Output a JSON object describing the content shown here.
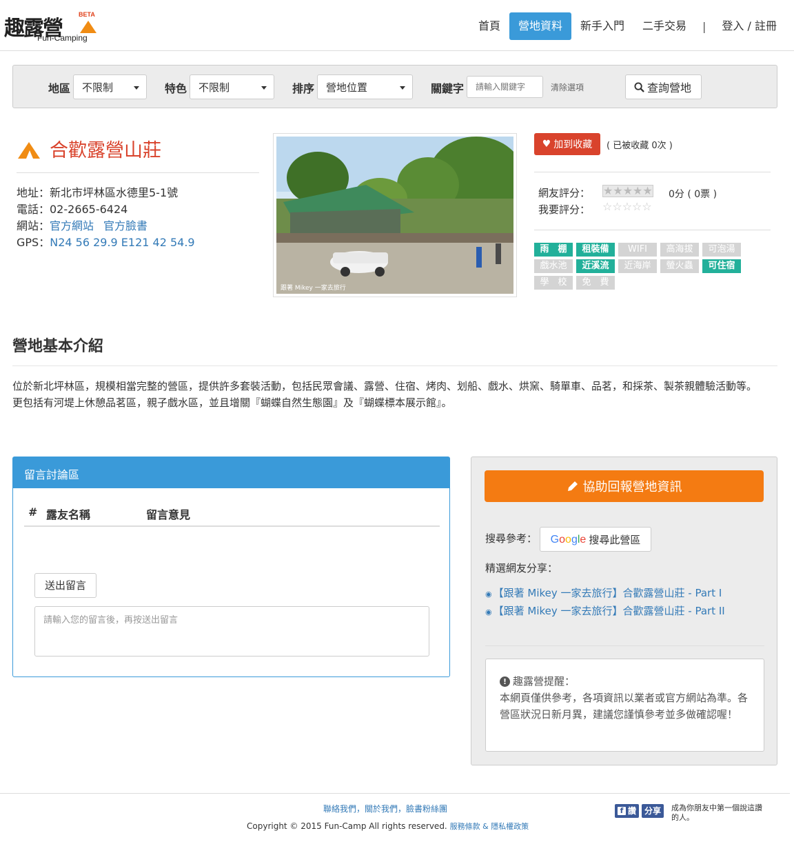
{
  "brand": {
    "name": "趣露營",
    "sub": "Fun-Camping",
    "beta": "BETA"
  },
  "nav": {
    "items": [
      {
        "label": "首頁",
        "active": false
      },
      {
        "label": "營地資料",
        "active": true
      },
      {
        "label": "新手入門",
        "active": false
      },
      {
        "label": "二手交易",
        "active": false
      }
    ],
    "separator": "|",
    "login": "登入 / 註冊"
  },
  "filter": {
    "region_label": "地區",
    "region_value": "不限制",
    "feature_label": "特色",
    "feature_value": "不限制",
    "sort_label": "排序",
    "sort_value": "營地位置",
    "keyword_label": "關鍵字",
    "keyword_placeholder": "請輸入關鍵字",
    "clear": "清除選項",
    "search_button": "查詢營地"
  },
  "camp": {
    "name": "合歡露營山莊",
    "address": "地址：新北市坪林區水德里5-1號",
    "phone": "電話：02-2665-6424",
    "website_label": "網站：",
    "website_links": [
      "官方網站",
      "官方臉書"
    ],
    "gps_label": "GPS：",
    "gps_value": "N24 56 29.9 E121 42 54.9",
    "photo_caption": "跟著 Mikey 一家去旅行"
  },
  "favorite": {
    "button": "加到收藏",
    "count_text": "( 已被收藏 0次 )"
  },
  "rating": {
    "user_label": "網友評分：",
    "my_label": "我要評分：",
    "stars": "★★★★★",
    "empty_stars": "☆☆☆☆☆",
    "value_text": "0分 ( 0票 )"
  },
  "tags": [
    {
      "label": "雨　棚",
      "on": true
    },
    {
      "label": "租裝備",
      "on": true
    },
    {
      "label": "WIFI",
      "on": false
    },
    {
      "label": "高海拔",
      "on": false
    },
    {
      "label": "可泡湯",
      "on": false
    },
    {
      "label": "戲水池",
      "on": false
    },
    {
      "label": "近溪流",
      "on": true
    },
    {
      "label": "近海岸",
      "on": false
    },
    {
      "label": "螢火蟲",
      "on": false
    },
    {
      "label": "可住宿",
      "on": true
    },
    {
      "label": "學　校",
      "on": false
    },
    {
      "label": "免　費",
      "on": false
    }
  ],
  "intro": {
    "title": "營地基本介紹",
    "line1": "位於新北坪林區，規模相當完整的營區，提供許多套裝活動，包括民眾會議、露營、住宿、烤肉、划船、戲水、烘窯、騎單車、品茗，和採茶、製茶親體驗活動等。",
    "line2": "更包括有河堤上休憩品茗區，親子戲水區，並且增關『蝴蝶自然生態園』及『蝴蝶標本展示館』。"
  },
  "comments": {
    "title": "留言討論區",
    "col_num": "#",
    "col_name": "露友名稱",
    "col_msg": "留言意見",
    "send": "送出留言",
    "placeholder": "請輸入您的留言後，再按送出留言"
  },
  "sidebar": {
    "report": "協助回報營地資訊",
    "search_label": "搜尋參考：",
    "google_button": "搜尋此營區",
    "share_label": "精選網友分享：",
    "links": [
      "【跟著 Mikey 一家去旅行】合歡露營山莊 - Part I",
      "【跟著 Mikey 一家去旅行】合歡露營山莊 - Part II"
    ],
    "note_title": "趣露營提醒：",
    "note_body": "本網頁僅供參考，各項資訊以業者或官方網站為準。各營區狀況日新月異，建議您謹慎參考並多做確認喔！"
  },
  "footer": {
    "links": "聯絡我們，關於我們，臉書粉絲團",
    "copyright": "Copyright © 2015 Fun-Camp All rights reserved.",
    "policy": "服務條款 & 隱私權政策",
    "fb_like": "讚",
    "fb_share": "分享",
    "fb_text": "成為你朋友中第一個說這讚的人。"
  },
  "colors": {
    "accent": "#3a9ad9",
    "brand_red": "#d9432c",
    "report_orange": "#f47b12",
    "tag_on": "#22b09a"
  }
}
